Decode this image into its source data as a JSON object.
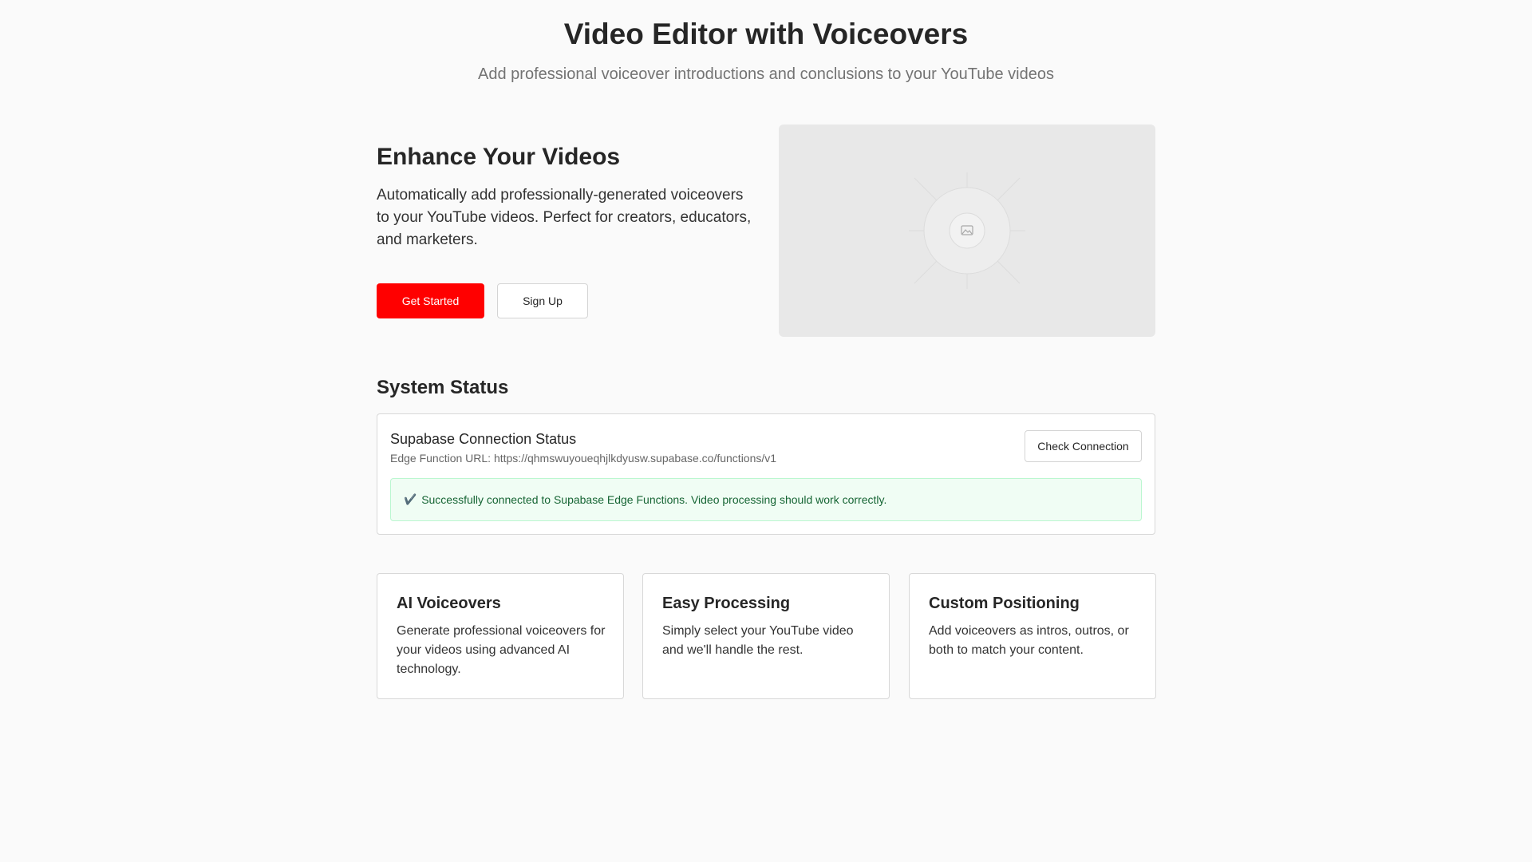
{
  "header": {
    "title": "Video Editor with Voiceovers",
    "subtitle": "Add professional voiceover introductions and conclusions to your YouTube videos"
  },
  "hero": {
    "title": "Enhance Your Videos",
    "description": "Automatically add professionally-generated voiceovers to your YouTube videos. Perfect for creators, educators, and marketers.",
    "primary_button": "Get Started",
    "secondary_button": "Sign Up",
    "image_icon": "image-placeholder-icon"
  },
  "system_status": {
    "section_title": "System Status",
    "card_title": "Supabase Connection Status",
    "edge_url": "Edge Function URL: https://qhmswuyoueqhjlkdyusw.supabase.co/functions/v1",
    "check_button": "Check Connection",
    "alert_icon": "✔️",
    "alert_text": "Successfully connected to Supabase Edge Functions. Video processing should work correctly."
  },
  "features": [
    {
      "title": "AI Voiceovers",
      "description": "Generate professional voiceovers for your videos using advanced AI technology."
    },
    {
      "title": "Easy Processing",
      "description": "Simply select your YouTube video and we'll handle the rest."
    },
    {
      "title": "Custom Positioning",
      "description": "Add voiceovers as intros, outros, or both to match your content."
    }
  ],
  "colors": {
    "accent": "#ff0000",
    "success_bg": "#f0fdf4",
    "success_text": "#166534"
  }
}
